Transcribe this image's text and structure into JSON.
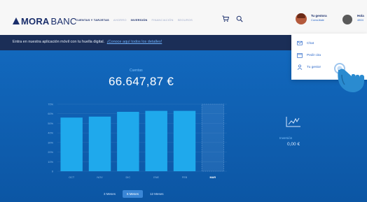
{
  "header": {
    "logo": {
      "bold": "MORA",
      "light": "BANC"
    },
    "nav": [
      {
        "label": "Cuentas y tarjetas",
        "active": true
      },
      {
        "label": "Ahorro",
        "active": false
      },
      {
        "label": "Inversión",
        "active": true
      },
      {
        "label": "Financiación",
        "active": false
      },
      {
        "label": "Seguros",
        "active": false
      }
    ],
    "icons": {
      "cart": "cart-icon",
      "search": "search-icon"
    }
  },
  "user": {
    "gestor_name": "Tu gestora",
    "gestor_sub": "Consúltale",
    "user_name": "Hola",
    "user_sub": "4804"
  },
  "banner": {
    "text": "Entra en nuestra aplicación móvil con tu huella digital.",
    "link": "¡Conoce aquí todos los detalles!"
  },
  "summary": {
    "section_label": "Cuentas",
    "balance": "66.647,87 €"
  },
  "side_panel": {
    "label": "Inversión",
    "value": "0,00 €",
    "icon": "trend-line-icon"
  },
  "period_tabs": [
    {
      "label": "3 Meses",
      "active": false
    },
    {
      "label": "6 Meses",
      "active": true
    },
    {
      "label": "12 Meses",
      "active": false
    }
  ],
  "dropdown": [
    {
      "icon": "chat-icon",
      "label": "Chat"
    },
    {
      "icon": "calendar-icon",
      "label": "Pedir cita"
    },
    {
      "icon": "person-icon",
      "label": "Tu gestor"
    }
  ],
  "colors": {
    "brand": "#1a2e6b",
    "banner": "#1b2e57",
    "main_blue": "#0f5fb3",
    "bar": "#1fa9ec",
    "link": "#2a67c9"
  },
  "chart_data": {
    "type": "bar",
    "categories": [
      "OCT",
      "NOV",
      "DIC",
      "ENE",
      "FEB",
      "MAR"
    ],
    "values": [
      56,
      57,
      62,
      63,
      63,
      0
    ],
    "highlight_index": 5,
    "ylim": [
      0,
      70
    ],
    "yticks": [
      "0",
      "10%",
      "20%",
      "30%",
      "40%",
      "50%",
      "60%",
      "70%"
    ],
    "grid": true
  }
}
